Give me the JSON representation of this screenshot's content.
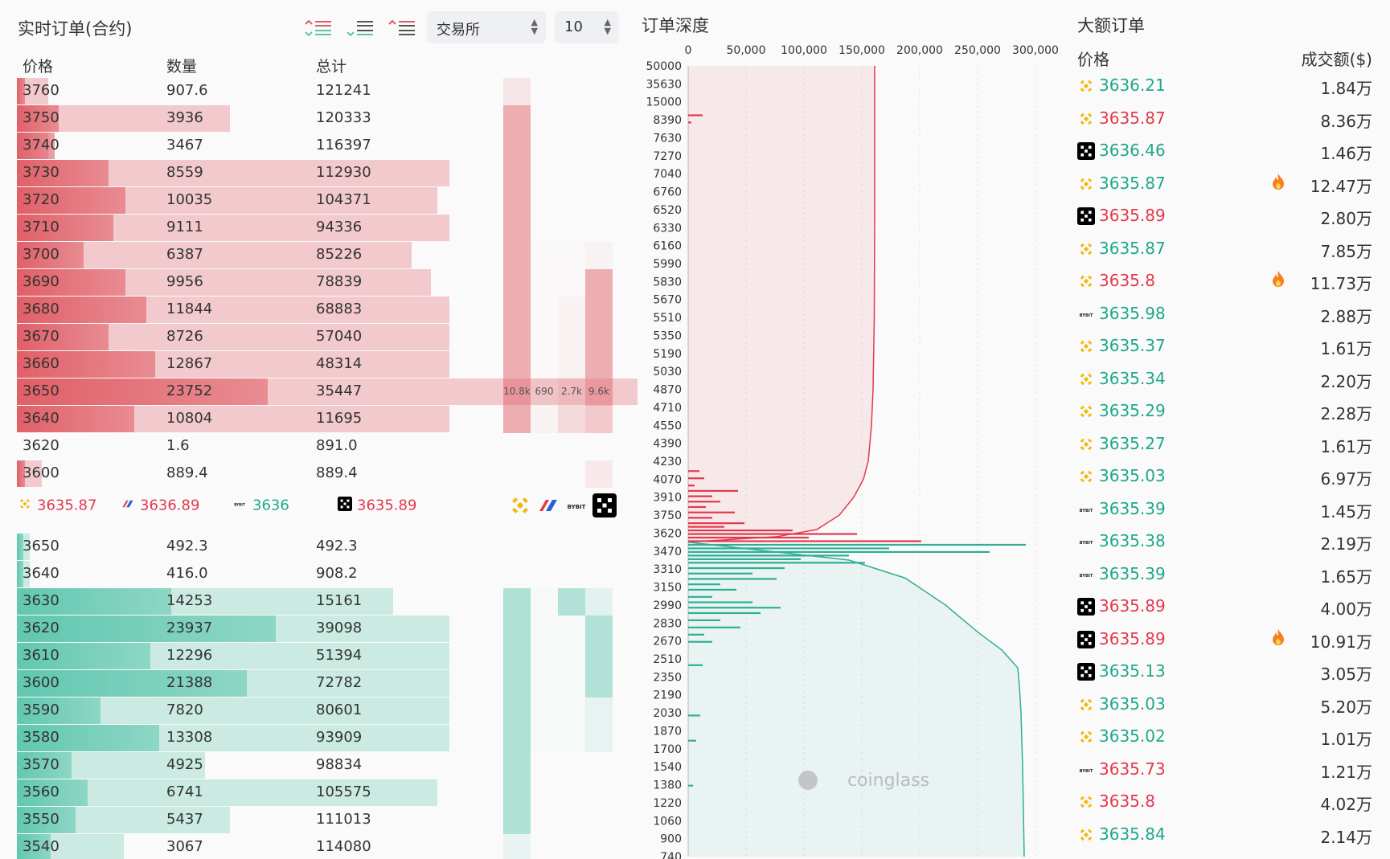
{
  "colors": {
    "ask": "#e05a63",
    "bid": "#5cc6ad",
    "ask_text": "#e2394c",
    "bid_text": "#1fa88c",
    "binance": "#f0b90b"
  },
  "orderbook": {
    "title": "实时订单(合约)",
    "exchange_select": "交易所",
    "depth_select": "10",
    "headers": {
      "price": "价格",
      "qty": "数量",
      "total": "总计"
    },
    "asks": [
      {
        "price": "3760",
        "qty": "907.6",
        "total": "121241",
        "bar": 0.02,
        "share": 0.05,
        "hm": [
          0.25,
          0,
          0,
          0
        ]
      },
      {
        "price": "3750",
        "qty": "3936",
        "total": "120333",
        "bar": 0.1,
        "share": 0.34,
        "hm": [
          0.95,
          0,
          0,
          0
        ]
      },
      {
        "price": "3740",
        "qty": "3467",
        "total": "116397",
        "bar": 0.09,
        "share": 0.05,
        "hm": [
          0.95,
          0,
          0,
          0
        ]
      },
      {
        "price": "3730",
        "qty": "8559",
        "total": "112930",
        "bar": 0.22,
        "share": 0.69,
        "hm": [
          0.95,
          0,
          0,
          0
        ]
      },
      {
        "price": "3720",
        "qty": "10035",
        "total": "104371",
        "bar": 0.26,
        "share": 0.67,
        "hm": [
          0.95,
          0,
          0,
          0
        ]
      },
      {
        "price": "3710",
        "qty": "9111",
        "total": "94336",
        "bar": 0.23,
        "share": 0.69,
        "hm": [
          0.95,
          0,
          0,
          0
        ]
      },
      {
        "price": "3700",
        "qty": "6387",
        "total": "85226",
        "bar": 0.16,
        "share": 0.63,
        "hm": [
          0.95,
          0.02,
          0.04,
          0.1
        ]
      },
      {
        "price": "3690",
        "qty": "9956",
        "total": "78839",
        "bar": 0.26,
        "share": 0.66,
        "hm": [
          0.95,
          0.02,
          0.04,
          0.95
        ]
      },
      {
        "price": "3680",
        "qty": "11844",
        "total": "68883",
        "bar": 0.31,
        "share": 0.69,
        "hm": [
          0.95,
          0.02,
          0.1,
          0.95
        ]
      },
      {
        "price": "3670",
        "qty": "8726",
        "total": "57040",
        "bar": 0.22,
        "share": 0.69,
        "hm": [
          0.95,
          0.02,
          0.1,
          0.95
        ]
      },
      {
        "price": "3660",
        "qty": "12867",
        "total": "48314",
        "bar": 0.33,
        "share": 0.69,
        "hm": [
          0.95,
          0.02,
          0.1,
          0.95
        ]
      },
      {
        "price": "3650",
        "qty": "23752",
        "total": "35447",
        "bar": 0.6,
        "share": 0.99,
        "hm": [
          0.95,
          0.1,
          0.3,
          0.9
        ],
        "hm_labels": [
          "10.8k",
          "690",
          "2.7k",
          "9.6k"
        ]
      },
      {
        "price": "3640",
        "qty": "10804",
        "total": "11695",
        "bar": 0.28,
        "share": 0.69,
        "hm": [
          0.95,
          0.1,
          0.4,
          0.6
        ]
      },
      {
        "price": "3620",
        "qty": "1.6",
        "total": "891.0",
        "bar": 0.0,
        "share": 0.0,
        "hm": [
          0,
          0,
          0,
          0
        ]
      },
      {
        "price": "3600",
        "qty": "889.4",
        "total": "889.4",
        "bar": 0.02,
        "share": 0.04,
        "hm": [
          0,
          0,
          0,
          0.2
        ]
      }
    ],
    "mid_prices": [
      {
        "exchange_icon": "binance-icon",
        "price": "3635.87",
        "color": "#e2394c"
      },
      {
        "exchange_icon": "bitmex-icon",
        "price": "3636.89",
        "color": "#e2394c"
      },
      {
        "exchange_icon": "bybit-icon",
        "price": "3636",
        "color": "#1fa88c"
      },
      {
        "exchange_icon": "okx-icon",
        "price": "3635.89",
        "color": "#e2394c"
      }
    ],
    "bids": [
      {
        "price": "3650",
        "qty": "492.3",
        "total": "492.3",
        "bar": 0.01,
        "share": 0.02,
        "hm": [
          0,
          0,
          0,
          0
        ]
      },
      {
        "price": "3640",
        "qty": "416.0",
        "total": "908.2",
        "bar": 0.01,
        "share": 0.02,
        "hm": [
          0,
          0,
          0,
          0
        ]
      },
      {
        "price": "3630",
        "qty": "14253",
        "total": "15161",
        "bar": 0.37,
        "share": 0.6,
        "hm": [
          0.95,
          0.05,
          0.9,
          0.3
        ]
      },
      {
        "price": "3620",
        "qty": "23937",
        "total": "39098",
        "bar": 0.62,
        "share": 0.69,
        "hm": [
          0.95,
          0.05,
          0.05,
          0.9
        ]
      },
      {
        "price": "3610",
        "qty": "12296",
        "total": "51394",
        "bar": 0.32,
        "share": 0.69,
        "hm": [
          0.95,
          0.05,
          0.05,
          0.9
        ]
      },
      {
        "price": "3600",
        "qty": "21388",
        "total": "72782",
        "bar": 0.55,
        "share": 0.69,
        "hm": [
          0.95,
          0.05,
          0.05,
          0.9
        ]
      },
      {
        "price": "3590",
        "qty": "7820",
        "total": "80601",
        "bar": 0.2,
        "share": 0.69,
        "hm": [
          0.95,
          0.05,
          0.05,
          0.25
        ]
      },
      {
        "price": "3580",
        "qty": "13308",
        "total": "93909",
        "bar": 0.34,
        "share": 0.69,
        "hm": [
          0.95,
          0.05,
          0.05,
          0.25
        ]
      },
      {
        "price": "3570",
        "qty": "4925",
        "total": "98834",
        "bar": 0.13,
        "share": 0.3,
        "hm": [
          0.95,
          0,
          0,
          0
        ]
      },
      {
        "price": "3560",
        "qty": "6741",
        "total": "105575",
        "bar": 0.17,
        "share": 0.67,
        "hm": [
          0.95,
          0,
          0,
          0
        ]
      },
      {
        "price": "3550",
        "qty": "5437",
        "total": "111013",
        "bar": 0.14,
        "share": 0.34,
        "hm": [
          0.95,
          0,
          0,
          0
        ]
      },
      {
        "price": "3540",
        "qty": "3067",
        "total": "114080",
        "bar": 0.08,
        "share": 0.17,
        "hm": [
          0.2,
          0,
          0,
          0
        ]
      }
    ]
  },
  "depth": {
    "title": "订单深度",
    "x_ticks": [
      "0",
      "50,000",
      "100,000",
      "150,000",
      "200,000",
      "250,000",
      "300,000"
    ],
    "y_ticks": [
      "50000",
      "35630",
      "15000",
      "8390",
      "7630",
      "7270",
      "7040",
      "6760",
      "6520",
      "6330",
      "6160",
      "5990",
      "5830",
      "5670",
      "5510",
      "5350",
      "5190",
      "5030",
      "4870",
      "4710",
      "4550",
      "4390",
      "4230",
      "4070",
      "3910",
      "3750",
      "3620",
      "3470",
      "3310",
      "3150",
      "2990",
      "2830",
      "2670",
      "2510",
      "2350",
      "2190",
      "2030",
      "1870",
      "1700",
      "1540",
      "1380",
      "1220",
      "1060",
      "900",
      "740"
    ],
    "watermark": "coinglass"
  },
  "large_orders": {
    "title": "大额订单",
    "headers": {
      "price": "价格",
      "amount": "成交额($)"
    },
    "rows": [
      {
        "icon": "binance-icon",
        "price": "3636.21",
        "side": "buy",
        "amount": "1.84万",
        "hot": false
      },
      {
        "icon": "binance-icon",
        "price": "3635.87",
        "side": "sell",
        "amount": "8.36万",
        "hot": false
      },
      {
        "icon": "okx-icon",
        "price": "3636.46",
        "side": "buy",
        "amount": "1.46万",
        "hot": false
      },
      {
        "icon": "binance-icon",
        "price": "3635.87",
        "side": "buy",
        "amount": "12.47万",
        "hot": true
      },
      {
        "icon": "okx-icon",
        "price": "3635.89",
        "side": "sell",
        "amount": "2.80万",
        "hot": false
      },
      {
        "icon": "binance-icon",
        "price": "3635.87",
        "side": "buy",
        "amount": "7.85万",
        "hot": false
      },
      {
        "icon": "binance-icon",
        "price": "3635.8",
        "side": "sell",
        "amount": "11.73万",
        "hot": true
      },
      {
        "icon": "bybit-icon",
        "price": "3635.98",
        "side": "buy",
        "amount": "2.88万",
        "hot": false
      },
      {
        "icon": "binance-icon",
        "price": "3635.37",
        "side": "buy",
        "amount": "1.61万",
        "hot": false
      },
      {
        "icon": "binance-icon",
        "price": "3635.34",
        "side": "buy",
        "amount": "2.20万",
        "hot": false
      },
      {
        "icon": "binance-icon",
        "price": "3635.29",
        "side": "buy",
        "amount": "2.28万",
        "hot": false
      },
      {
        "icon": "binance-icon",
        "price": "3635.27",
        "side": "buy",
        "amount": "1.61万",
        "hot": false
      },
      {
        "icon": "binance-icon",
        "price": "3635.03",
        "side": "buy",
        "amount": "6.97万",
        "hot": false
      },
      {
        "icon": "bybit-icon",
        "price": "3635.39",
        "side": "buy",
        "amount": "1.45万",
        "hot": false
      },
      {
        "icon": "bybit-icon",
        "price": "3635.38",
        "side": "buy",
        "amount": "2.19万",
        "hot": false
      },
      {
        "icon": "bybit-icon",
        "price": "3635.39",
        "side": "buy",
        "amount": "1.65万",
        "hot": false
      },
      {
        "icon": "okx-icon",
        "price": "3635.89",
        "side": "sell",
        "amount": "4.00万",
        "hot": false
      },
      {
        "icon": "okx-icon",
        "price": "3635.89",
        "side": "sell",
        "amount": "10.91万",
        "hot": true
      },
      {
        "icon": "okx-icon",
        "price": "3635.13",
        "side": "buy",
        "amount": "3.05万",
        "hot": false
      },
      {
        "icon": "binance-icon",
        "price": "3635.03",
        "side": "buy",
        "amount": "5.20万",
        "hot": false
      },
      {
        "icon": "binance-icon",
        "price": "3635.02",
        "side": "buy",
        "amount": "1.01万",
        "hot": false
      },
      {
        "icon": "bybit-icon",
        "price": "3635.73",
        "side": "sell",
        "amount": "1.21万",
        "hot": false
      },
      {
        "icon": "binance-icon",
        "price": "3635.8",
        "side": "sell",
        "amount": "4.02万",
        "hot": false
      },
      {
        "icon": "binance-icon",
        "price": "3635.84",
        "side": "buy",
        "amount": "2.14万",
        "hot": false
      }
    ]
  }
}
